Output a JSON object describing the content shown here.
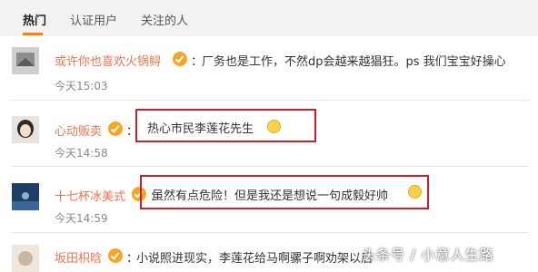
{
  "tabs": [
    "热门",
    "认证用户",
    "关注的人"
  ],
  "colors": {
    "accent": "#ff8200",
    "username": "#eb7350",
    "highlight_border": "#c8202a",
    "badge": "#f5a623"
  },
  "comments": [
    {
      "username": "或许你也喜欢火锅鲟",
      "text": "厂务也是工作，不然dp会越来越猖狂。ps 我们宝宝好操心",
      "time": "今天15:03"
    },
    {
      "username": "心动贩卖",
      "text": "热心市民李莲花先生",
      "time": "今天14:58",
      "emoji": "laugh-emoji"
    },
    {
      "username": "十七杯冰美式",
      "text": "虽然有点危险！但是我还是想说一句成毅好帅",
      "time": "今天14:59",
      "emoji": "wink-emoji"
    },
    {
      "username": "坂田枳晗",
      "text": "小说照进现实，李莲花给马啊骡子啊劝架以后"
    }
  ],
  "watermark": "头条号 / 小意人生路"
}
